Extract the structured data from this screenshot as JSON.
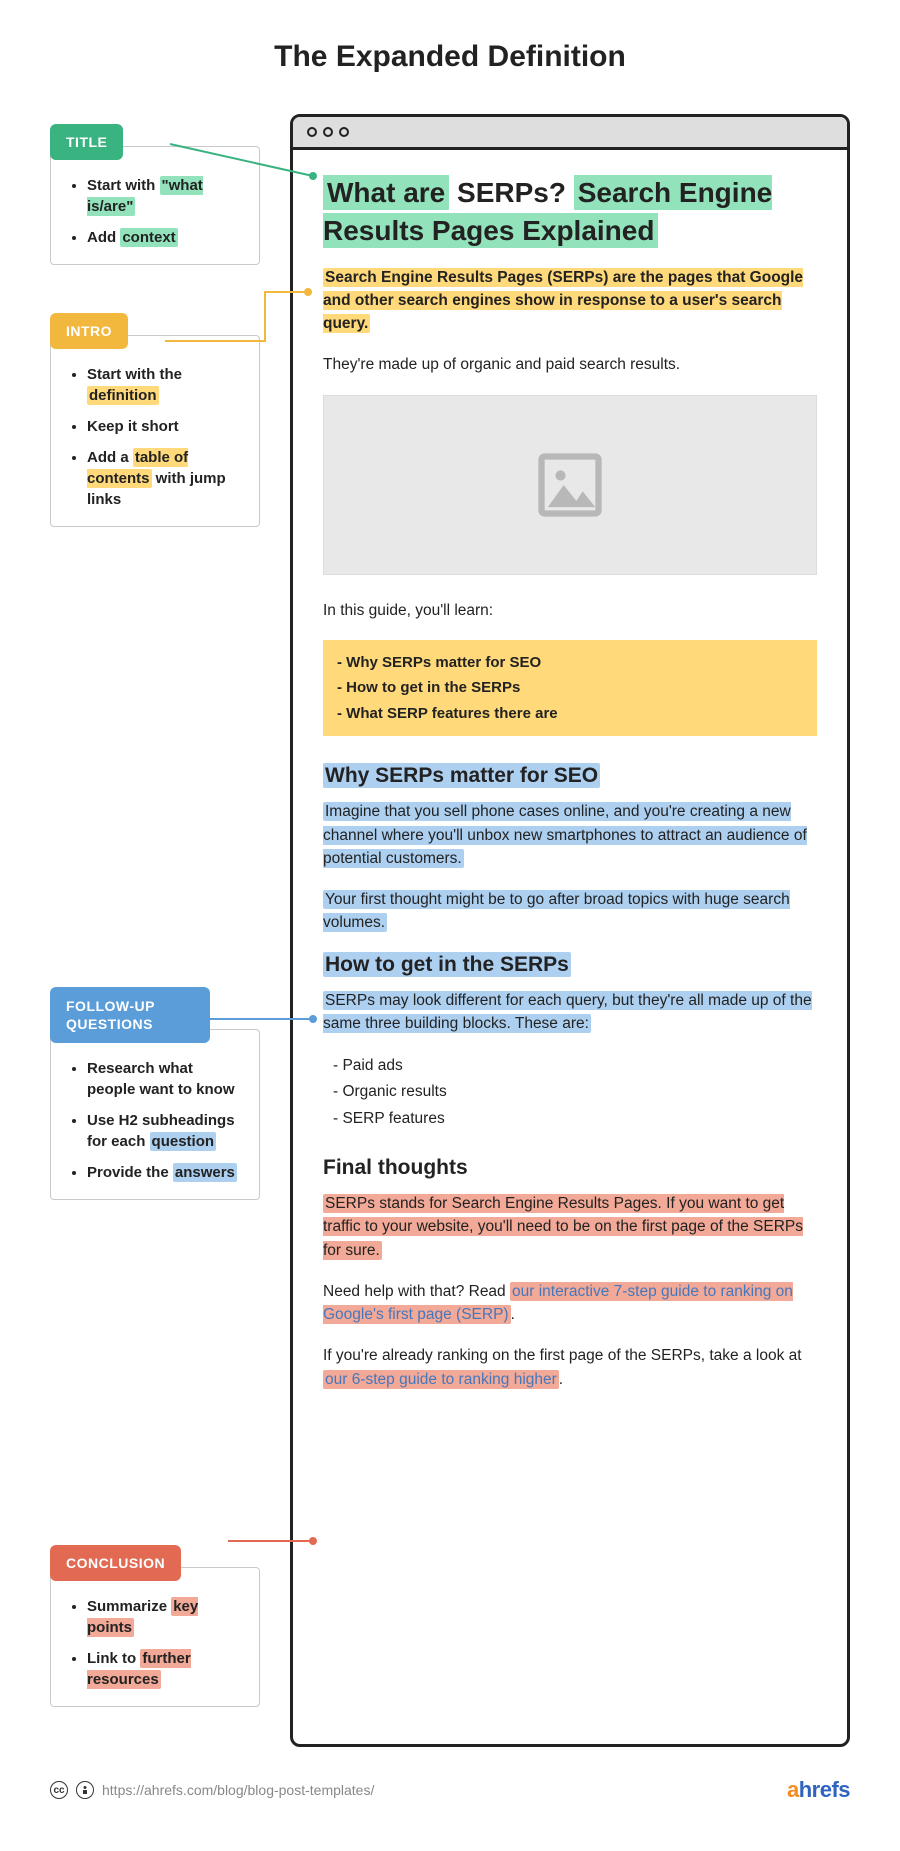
{
  "pageTitle": "The Expanded Definition",
  "sidebar": {
    "title": {
      "label": "TITLE",
      "bullets": [
        {
          "pre": "Start with ",
          "hl": "\"what is/are\""
        },
        {
          "pre": "Add ",
          "hl": "context"
        }
      ]
    },
    "intro": {
      "label": "INTRO",
      "bullets": [
        {
          "pre": "Start with the ",
          "hl": "definition"
        },
        {
          "pre": "Keep it short"
        },
        {
          "pre": "Add a ",
          "hl": "table of contents",
          "post": " with jump links"
        }
      ]
    },
    "follow": {
      "label": "FOLLOW-UP QUESTIONS",
      "bullets": [
        {
          "pre": "Research what people want to know"
        },
        {
          "pre": "Use H2 subheadings for each ",
          "hl": "question"
        },
        {
          "pre": "Provide the ",
          "hl": "answers"
        }
      ]
    },
    "conclusion": {
      "label": "CONCLUSION",
      "bullets": [
        {
          "pre": "Summarize ",
          "hl": "key points"
        },
        {
          "pre": "Link to ",
          "hl": "further resources"
        }
      ]
    }
  },
  "article": {
    "title": {
      "hl1": "What are",
      "plain": " SERPs? ",
      "hl2": "Search Engine Results Pages Explained"
    },
    "introP": "Search Engine Results Pages (SERPs) are the pages that Google and other search engines show in response to a user's search query.",
    "p1": "They're made up of organic and paid search results.",
    "guideIntro": "In this guide, you'll learn:",
    "toc": [
      "Why SERPs matter for SEO",
      "How to get in the SERPs",
      "What SERP features there are"
    ],
    "s1": {
      "heading": "Why SERPs matter for SEO",
      "p1": "Imagine that you sell phone cases online, and you're creating a new channel where you'll unbox new smartphones to attract an audience of potential customers.",
      "p2": "Your first thought might be to go after broad topics with huge search volumes."
    },
    "s2": {
      "heading": "How to get in the SERPs",
      "p1": "SERPs may look different for each query, but they're all made up of the same three building blocks. These are:",
      "list": [
        "Paid ads",
        "Organic results",
        "SERP features"
      ]
    },
    "s3": {
      "heading": "Final thoughts",
      "p1": "SERPs stands for Search Engine Results Pages. If you want to get traffic to your website, you'll need to be on the first page of the SERPs for sure.",
      "p2_pre": "Need help with that? Read ",
      "p2_link": "our interactive 7-step guide to ranking on Google's first page (SERP)",
      "p2_post": ".",
      "p3_pre": "If you're already ranking on the first page of the SERPs, take a look at ",
      "p3_link": "our 6-step guide to ranking higher",
      "p3_post": "."
    }
  },
  "footer": {
    "url": "https://ahrefs.com/blog/blog-post-templates/",
    "brand_a": "a",
    "brand_rest": "hrefs"
  }
}
